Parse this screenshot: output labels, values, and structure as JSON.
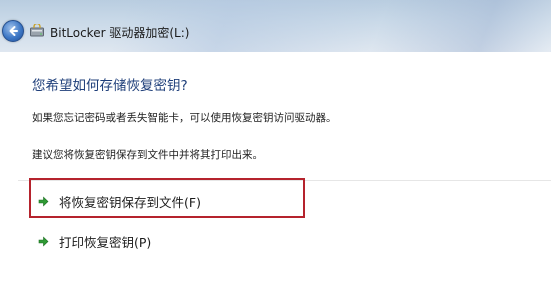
{
  "window": {
    "title": "BitLocker 驱动器加密(L:)",
    "back_icon": "back-arrow-icon",
    "app_icon": "bitlocker-drive-icon"
  },
  "content": {
    "heading": "您希望如何存储恢复密钥?",
    "paragraph1": "如果您忘记密码或者丢失智能卡，可以使用恢复密钥访问驱动器。",
    "paragraph2": "建议您将恢复密钥保存到文件中并将其打印出来。",
    "options": [
      {
        "label": "将恢复密钥保存到文件(F)",
        "icon": "green-arrow-icon",
        "highlighted": true
      },
      {
        "label": "打印恢复密钥(P)",
        "icon": "green-arrow-icon",
        "highlighted": false
      }
    ]
  },
  "colors": {
    "heading": "#1f3f7a",
    "highlight_border": "#b5232d",
    "arrow": "#2e9a34"
  }
}
